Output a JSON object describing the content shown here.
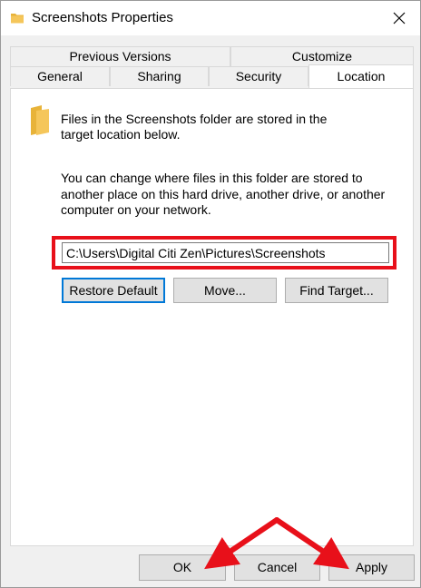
{
  "window": {
    "title": "Screenshots Properties"
  },
  "tabs": {
    "row1": [
      {
        "label": "Previous Versions"
      },
      {
        "label": "Customize"
      }
    ],
    "row2": [
      {
        "label": "General"
      },
      {
        "label": "Sharing"
      },
      {
        "label": "Security"
      },
      {
        "label": "Location"
      }
    ],
    "active": "Location"
  },
  "location": {
    "info_line1": "Files in the Screenshots folder are stored in the",
    "info_line2": "target location below.",
    "desc_line1": "You can change where files in this folder are stored to",
    "desc_line2": "another place on this hard drive, another drive, or another",
    "desc_line3": "computer on your network.",
    "path_value": "C:\\Users\\Digital Citi Zen\\Pictures\\Screenshots",
    "restore_default_label": "Restore Default",
    "move_label": "Move...",
    "find_target_label": "Find Target..."
  },
  "footer": {
    "ok_label": "OK",
    "cancel_label": "Cancel",
    "apply_label": "Apply"
  },
  "colors": {
    "highlight": "#e8101a",
    "folder": "#f5c65a",
    "focus": "#0078d7"
  },
  "icons": {
    "title": "folder-icon",
    "close": "close-icon",
    "location": "folder-icon"
  }
}
